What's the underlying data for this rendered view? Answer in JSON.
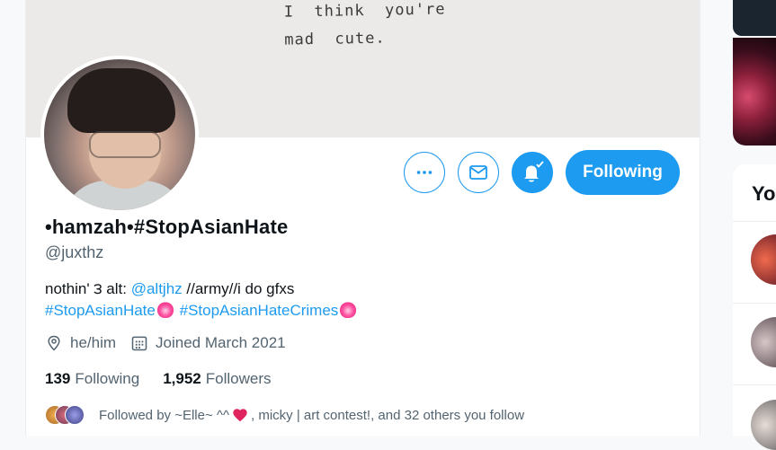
{
  "banner": {
    "line1": "I  think  you're",
    "line2": "mad  cute."
  },
  "profile": {
    "display_name": "•hamzah•#StopAsianHate",
    "handle": "@juxthz",
    "bio": {
      "text1": "nothin' ౩ alt: ",
      "mention": "@altjhz",
      "text2": " //army//i do gfxs",
      "hashtag1": "#StopAsianHate",
      "hashtag2": "#StopAsianHateCrimes"
    },
    "pronouns": "he/him",
    "joined": "Joined March 2021",
    "following_count": "139",
    "following_label": "Following",
    "followers_count": "1,952",
    "followers_label": "Followers",
    "followed_by_prefix": "Followed by ~Elle~ ^^ ",
    "followed_by_suffix": ", micky | art contest!, and 32 others you follow"
  },
  "actions": {
    "more_icon": "more-icon",
    "message_icon": "envelope-icon",
    "notify_icon": "bell-check-icon",
    "follow_label": "Following"
  },
  "sidebar": {
    "title_partial": "Yo"
  },
  "colors": {
    "accent": "#1d9bf0",
    "text": "#0f1419",
    "secondary_text": "#536471",
    "heart": "#e0245e"
  }
}
